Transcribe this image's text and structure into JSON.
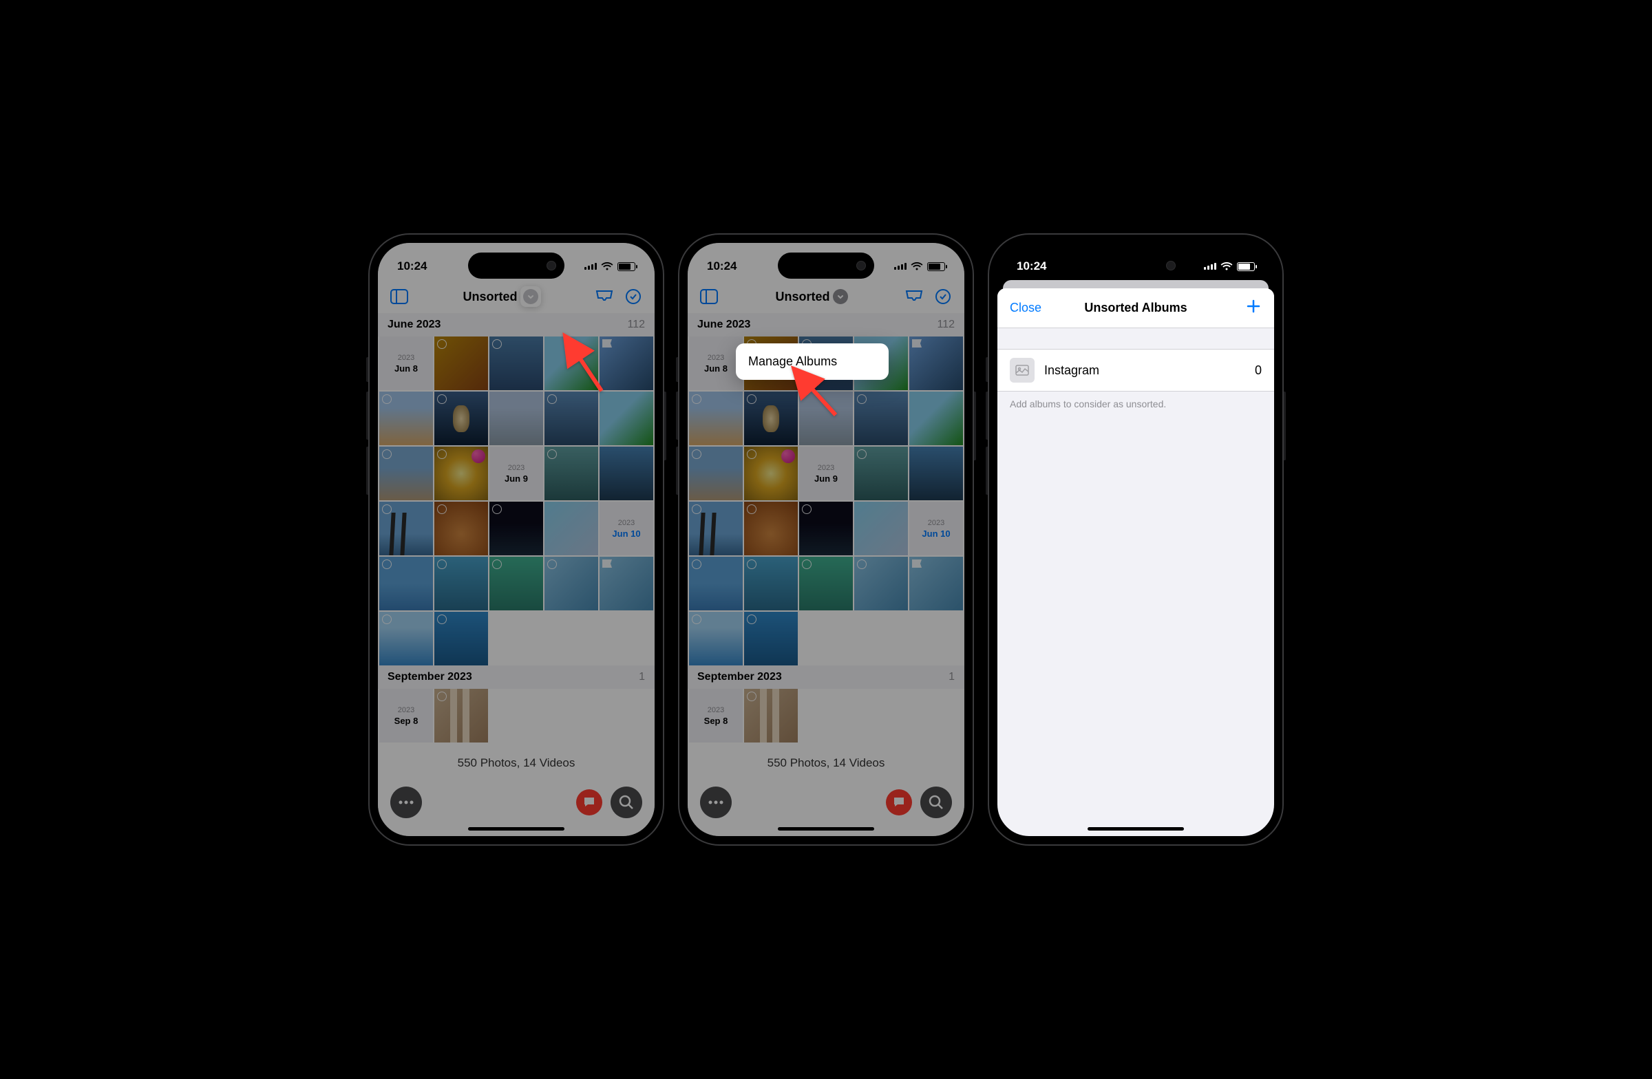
{
  "status": {
    "time": "10:24"
  },
  "toolbar": {
    "title": "Unsorted"
  },
  "sections": {
    "june": {
      "label": "June 2023",
      "count": "112"
    },
    "sept": {
      "label": "September 2023",
      "count": "1"
    }
  },
  "dates": {
    "jun8": {
      "year": "2023",
      "day": "Jun 8"
    },
    "jun9": {
      "year": "2023",
      "day": "Jun 9"
    },
    "jun10": {
      "year": "2023",
      "day": "Jun 10"
    },
    "sep8": {
      "year": "2023",
      "day": "Sep 8"
    }
  },
  "summary": "550 Photos, 14 Videos",
  "popover": {
    "manage": "Manage Albums"
  },
  "sheet": {
    "close": "Close",
    "title": "Unsorted Albums",
    "row": {
      "name": "Instagram",
      "count": "0"
    },
    "hint": "Add albums to consider as unsorted."
  }
}
